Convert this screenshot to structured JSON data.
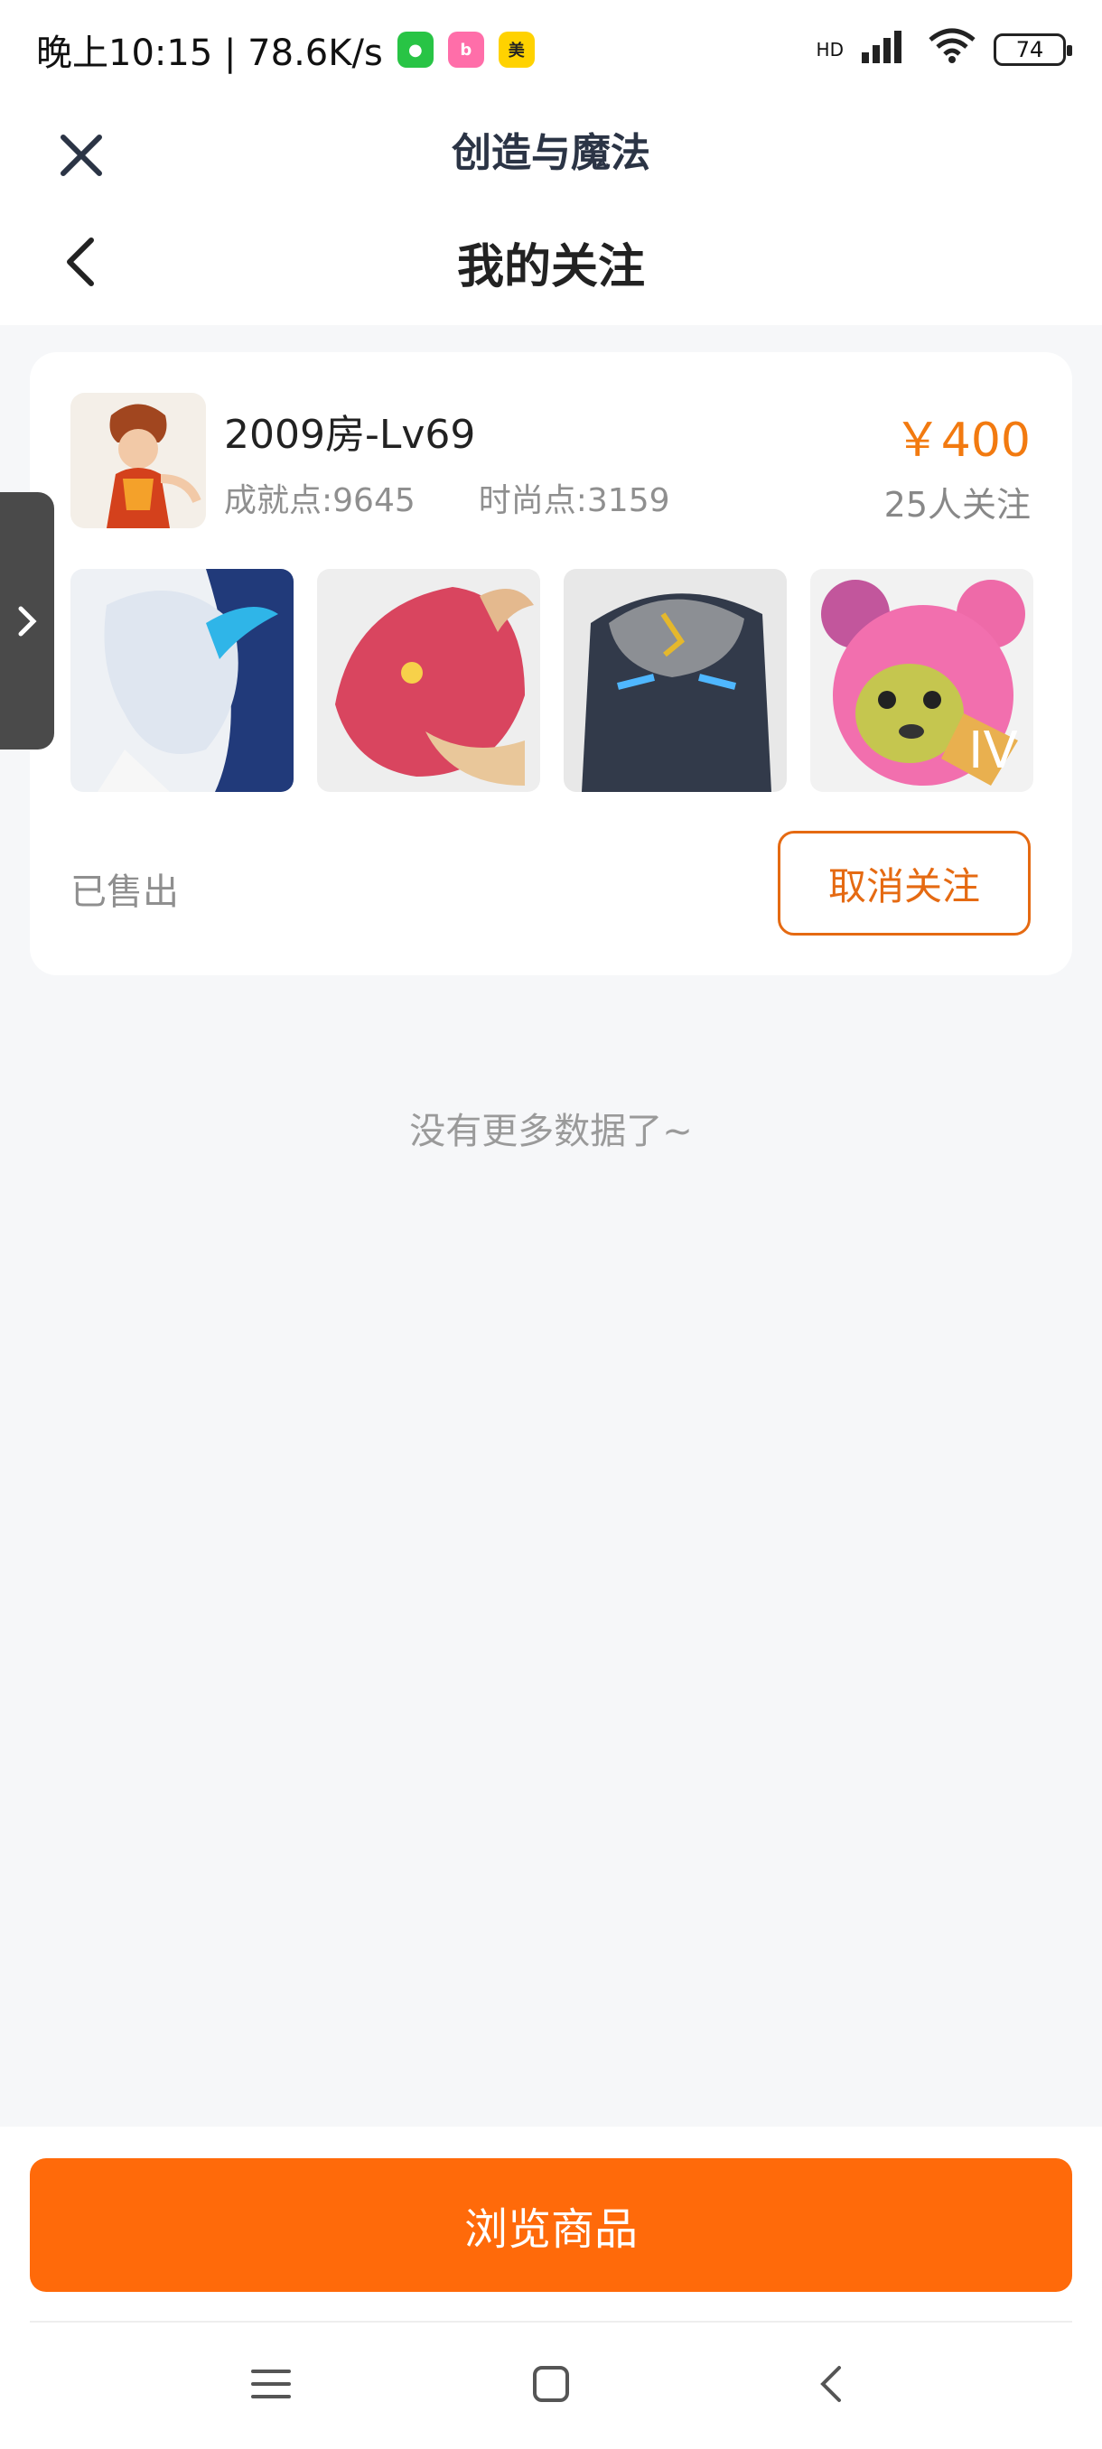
{
  "status_bar": {
    "time_speed": "晚上10:15 | 78.6K/s",
    "apps": [
      {
        "name": "wechat-icon",
        "color": "#2ecc71",
        "glyph": "●"
      },
      {
        "name": "bilibili-icon",
        "color": "#ff6ea9",
        "glyph": "bili"
      },
      {
        "name": "meituan-icon",
        "color": "#ffd200",
        "glyph": "美团"
      }
    ],
    "network": "HD",
    "battery": "74"
  },
  "mini_program": {
    "title": "创造与魔法"
  },
  "header": {
    "title": "我的关注"
  },
  "card": {
    "title": "2009房-Lv69",
    "achievement": "成就点:9645",
    "fashion": "时尚点:3159",
    "price": "￥400",
    "followers": "25人关注",
    "status": "已售出",
    "unfollow_label": "取消关注",
    "thumbnails": [
      "dragon-mask-white",
      "red-dragon-head",
      "dark-armor-mask",
      "pink-bear-IV"
    ]
  },
  "list_end": "没有更多数据了~",
  "bottom": {
    "browse_label": "浏览商品"
  },
  "colors": {
    "accent": "#ff6a0a",
    "price": "#f27a10",
    "outline": "#e56a12"
  }
}
